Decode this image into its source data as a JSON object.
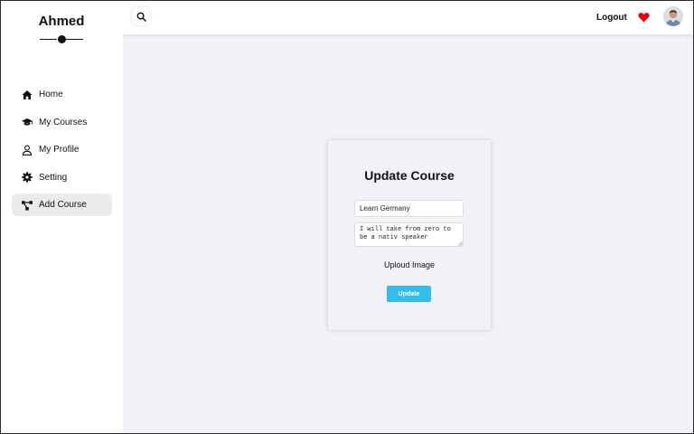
{
  "brand": {
    "name": "Ahmed"
  },
  "sidebar": {
    "items": [
      {
        "label": "Home",
        "icon": "home-icon",
        "active": false
      },
      {
        "label": "My Courses",
        "icon": "graduation-cap-icon",
        "active": false
      },
      {
        "label": "My Profile",
        "icon": "user-icon",
        "active": false
      },
      {
        "label": "Setting",
        "icon": "gear-icon",
        "active": false
      },
      {
        "label": "Add Course",
        "icon": "network-icon",
        "active": true
      }
    ]
  },
  "topbar": {
    "search_icon": "search-icon",
    "logout_label": "Logout",
    "heart_icon": "heart-icon",
    "heart_color": "#e8000b",
    "avatar": "avatar"
  },
  "form": {
    "title": "Update Course",
    "name_value": "Learn Germany",
    "description_value": "I will take from zero to be a nativ speaker",
    "upload_label": "Uploud Image",
    "submit_label": "Update"
  },
  "colors": {
    "background": "#f0f2f7",
    "panel": "#ffffff",
    "accent": "#33bee9",
    "active_item": "#ebebeb"
  }
}
